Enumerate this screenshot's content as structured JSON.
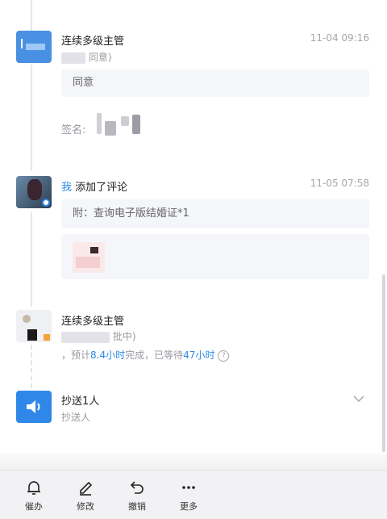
{
  "timeline": [
    {
      "title": "连续多级主管",
      "time": "11-04 09:16",
      "status": "同意)",
      "comment": "同意",
      "signature_label": "签名:"
    },
    {
      "actor": "我",
      "action": " 添加了评论",
      "time": "11-05 07:58",
      "comment": "附：查询电子版结婚证*1"
    },
    {
      "title": "连续多级主管",
      "status": "批中)",
      "estimate_prefix": "，预计",
      "estimate_value": "8.4小时",
      "estimate_mid": "完成，已等待",
      "waited_value": "47小时",
      "help": "?"
    },
    {
      "title": "抄送1人",
      "subtitle": "抄送人"
    }
  ],
  "toolbar": {
    "urge": "催办",
    "edit": "修改",
    "revoke": "撤销",
    "more": "更多"
  },
  "colors": {
    "accent": "#2f88e8",
    "muted": "#9a9aa2"
  },
  "icons": [
    "bell-icon",
    "pencil-icon",
    "undo-icon",
    "more-dots-icon",
    "speaker-icon",
    "chevron-down-icon",
    "help-circle-icon"
  ]
}
